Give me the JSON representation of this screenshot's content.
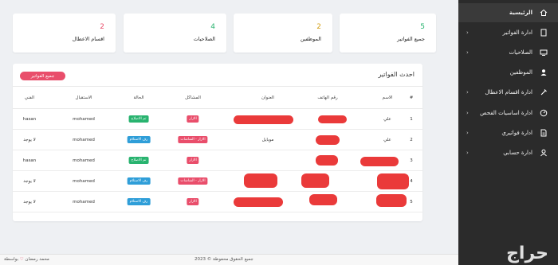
{
  "sidebar": {
    "items": [
      {
        "label": "الرئيسية",
        "icon": "home-icon",
        "chevron": ""
      },
      {
        "label": "ادارة الفواتير",
        "icon": "document-icon",
        "chevron": "‹"
      },
      {
        "label": "الصلاحيات",
        "icon": "display-icon",
        "chevron": "‹"
      },
      {
        "label": "الموظفين",
        "icon": "user-icon",
        "chevron": ""
      },
      {
        "label": "ادارة اقسام الاعطال",
        "icon": "tools-icon",
        "chevron": "‹"
      },
      {
        "label": "ادارة اساسيات الفحص",
        "icon": "gauge-icon",
        "chevron": "‹"
      },
      {
        "label": "ادارة فواتيري",
        "icon": "file-icon",
        "chevron": "‹"
      },
      {
        "label": "ادارة حسابي",
        "icon": "account-icon",
        "chevron": "‹"
      }
    ]
  },
  "stats": [
    {
      "value": "5",
      "label": "جميع الفواتير",
      "color": "#28b36f"
    },
    {
      "value": "2",
      "label": "الموظفين",
      "color": "#d4a017"
    },
    {
      "value": "4",
      "label": "الصلاحيات",
      "color": "#28b36f"
    },
    {
      "value": "2",
      "label": "اقسام الاعطال",
      "color": "#e94e6b"
    }
  ],
  "invoices": {
    "title": "احدث الفواتير",
    "all_button": "جميع الفواتير",
    "headers": {
      "index": "#",
      "name": "الاسم",
      "phone": "رقم الهاتف",
      "address": "العنوان",
      "problems": "المشاكل",
      "status": "الحالة",
      "receiver": "الاستقبال",
      "technician": "الفني"
    },
    "rows": [
      {
        "index": "1",
        "name": "علي",
        "address": "",
        "problems": "الازار",
        "status": "تم الاصلاح",
        "receiver": "mohamed",
        "technician": "hasan"
      },
      {
        "index": "2",
        "name": "علي",
        "address": "موبايل",
        "problems": "الازار - الشاشات",
        "status": "رف الاستلام",
        "receiver": "mohamed",
        "technician": "لا يوجد"
      },
      {
        "index": "3",
        "name": "",
        "address": "",
        "problems": "الازار",
        "status": "تم الاصلاح",
        "receiver": "mohamed",
        "technician": "hasan"
      },
      {
        "index": "4",
        "name": "",
        "address": "",
        "problems": "الازار - الشاشات",
        "status": "رف الاستلام",
        "receiver": "mohamed",
        "technician": "لا يوجد"
      },
      {
        "index": "5",
        "name": "",
        "address": "",
        "problems": "الازار",
        "status": "رف الاستلام",
        "receiver": "mohamed",
        "technician": "لا يوجد"
      }
    ]
  },
  "footer": {
    "copyright": "جميع الحقوق محفوظة © 2023",
    "credit_prefix": "بواسطة",
    "credit_name": "محمد رمضان"
  },
  "watermark": "حراج"
}
